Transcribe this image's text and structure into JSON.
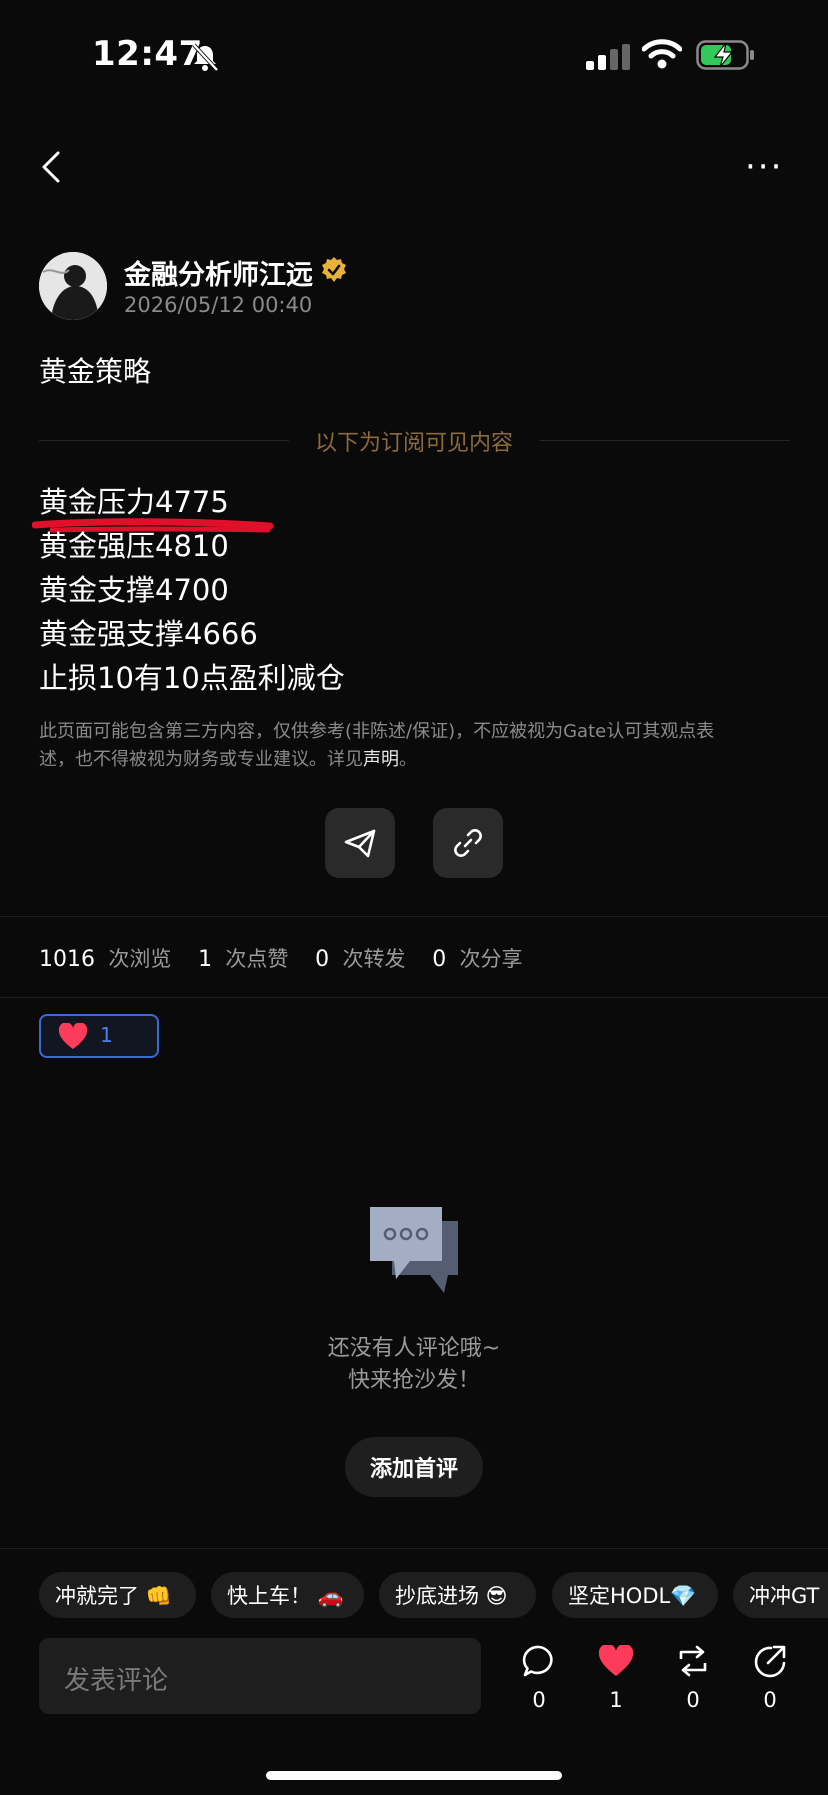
{
  "status": {
    "time": "12:47"
  },
  "author": {
    "name": "金融分析师江远",
    "date": "2026/05/12 00:40"
  },
  "post": {
    "title": "黄金策略",
    "subscribers_divider": "以下为订阅可见内容",
    "lines": [
      "黄金压力4775",
      "黄金强压4810",
      "黄金支撑4700",
      "黄金强支撑4666",
      "止损10有10点盈利减仓"
    ],
    "disclaimer_line1": "此页面可能包含第三方内容，仅供参考(非陈述/保证)，不应被视为Gate认可其观点表",
    "disclaimer_line2": "述，也不得被视为财务或专业建议。详见",
    "disclaimer_link": "声明",
    "disclaimer_end": "。"
  },
  "stats": {
    "views": "1016",
    "views_label": "次浏览",
    "likes": "1",
    "likes_label": "次点赞",
    "reposts": "0",
    "reposts_label": "次转发",
    "shares": "0",
    "shares_label": "次分享"
  },
  "reaction": {
    "count": "1"
  },
  "empty": {
    "line1": "还没有人评论哦~",
    "line2": "快来抢沙发！",
    "button": "添加首评"
  },
  "chips": [
    "冲就完了 👊",
    "快上车！ 🚗",
    "抄底进场 😎",
    "坚定HODL💎",
    "冲冲GT"
  ],
  "comment": {
    "placeholder": "发表评论"
  },
  "actions": {
    "comments": "0",
    "likes": "1",
    "reposts": "0",
    "shares": "0"
  },
  "colors": {
    "background": "#0a0a0a",
    "accent_gold": "#8b6a3c",
    "verified_gold": "#e8b13a",
    "like_red": "#ff3b5c",
    "reaction_blue": "#3a6ad8"
  },
  "icons": [
    "back-icon",
    "more-icon",
    "verified-icon",
    "share-telegram-icon",
    "copy-link-icon",
    "heart-icon",
    "chat-bubbles-icon",
    "comment-icon",
    "repost-icon",
    "share-icon"
  ]
}
